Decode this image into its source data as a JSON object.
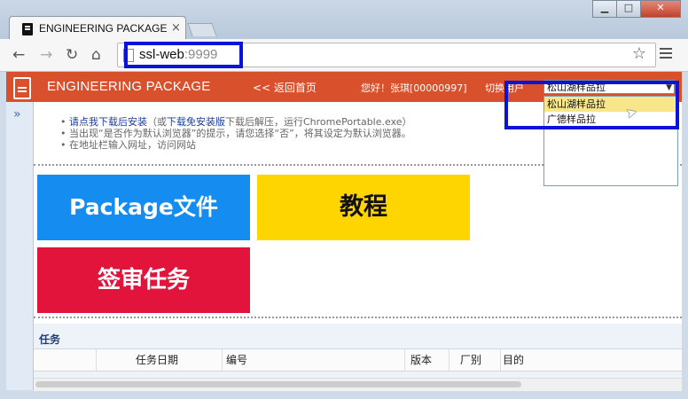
{
  "browser": {
    "tab_title": "ENGINEERING PACKAGE",
    "tab_close": "×",
    "url_host": "ssl-web",
    "url_port": ":9999"
  },
  "header": {
    "app_title": "ENGINEERING PACKAGE",
    "back_link": "<< 返回首页",
    "greeting": "您好！张琪[00000997]",
    "switch_user_label": "切换用户",
    "selected_user": "松山湖样品拉",
    "dropdown_options": [
      "松山湖样品拉",
      "广德样品拉"
    ]
  },
  "notes": {
    "line1_link1": "请点我下载后安装",
    "line1_text1": "（或",
    "line1_link2": "下载免安装版",
    "line1_text2": "下载后解压，运行ChromePortable.exe）",
    "line2": "当出现“是否作为默认浏览器”的提示，请您选择“否”，将其设定为默认浏览器。",
    "line3": "在地址栏输入网址，访问网站"
  },
  "tiles": {
    "package": "Package文件",
    "tutorial": "教程",
    "review": "签审任务"
  },
  "tasks": {
    "title": "任务",
    "columns": [
      "任务日期",
      "编号",
      "版本",
      "厂别",
      "目的"
    ]
  },
  "colors": {
    "header_bg": "#d9512c",
    "tile_package": "#148cf0",
    "tile_tutorial": "#ffd500",
    "tile_review": "#e2143c",
    "highlight": "#0a14d8"
  }
}
